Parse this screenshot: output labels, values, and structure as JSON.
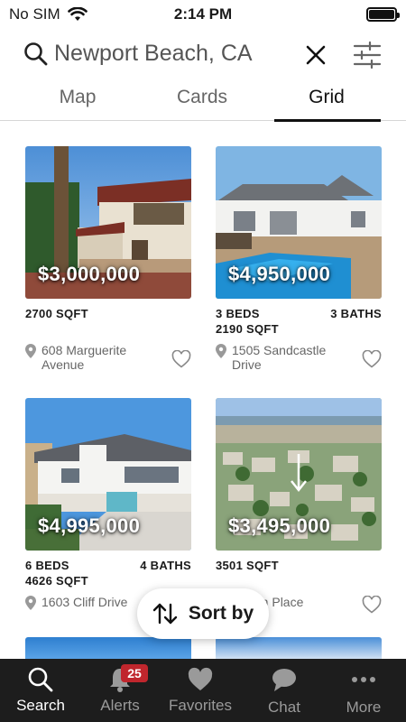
{
  "status_bar": {
    "carrier": "No SIM",
    "time": "2:14 PM"
  },
  "search": {
    "query": "Newport Beach, CA"
  },
  "tabs": [
    {
      "label": "Map",
      "active": false
    },
    {
      "label": "Cards",
      "active": false
    },
    {
      "label": "Grid",
      "active": true
    }
  ],
  "listings": [
    {
      "price": "$3,000,000",
      "beds": "",
      "baths": "",
      "sqft": "2700 SQFT",
      "address": "608 Marguerite Avenue"
    },
    {
      "price": "$4,950,000",
      "beds": "3 BEDS",
      "baths": "3 BATHS",
      "sqft": "2190 SQFT",
      "address": "1505 Sandcastle Drive"
    },
    {
      "price": "$4,995,000",
      "beds": "6 BEDS",
      "baths": "4 BATHS",
      "sqft": "4626 SQFT",
      "address": "1603 Cliff Drive"
    },
    {
      "price": "$3,495,000",
      "beds": "",
      "baths": "",
      "sqft": "3501 SQFT",
      "address": "Haven Place"
    }
  ],
  "sort": {
    "label": "Sort by"
  },
  "bottom_nav": [
    {
      "label": "Search",
      "icon": "search-icon",
      "active": true
    },
    {
      "label": "Alerts",
      "icon": "bell-icon",
      "badge": "25"
    },
    {
      "label": "Favorites",
      "icon": "heart-icon"
    },
    {
      "label": "Chat",
      "icon": "chat-bubble-icon"
    },
    {
      "label": "More",
      "icon": "more-dots-icon"
    }
  ],
  "colors": {
    "accent": "#111111",
    "badge": "#c0262d",
    "nav_background": "#1d1d1d"
  }
}
